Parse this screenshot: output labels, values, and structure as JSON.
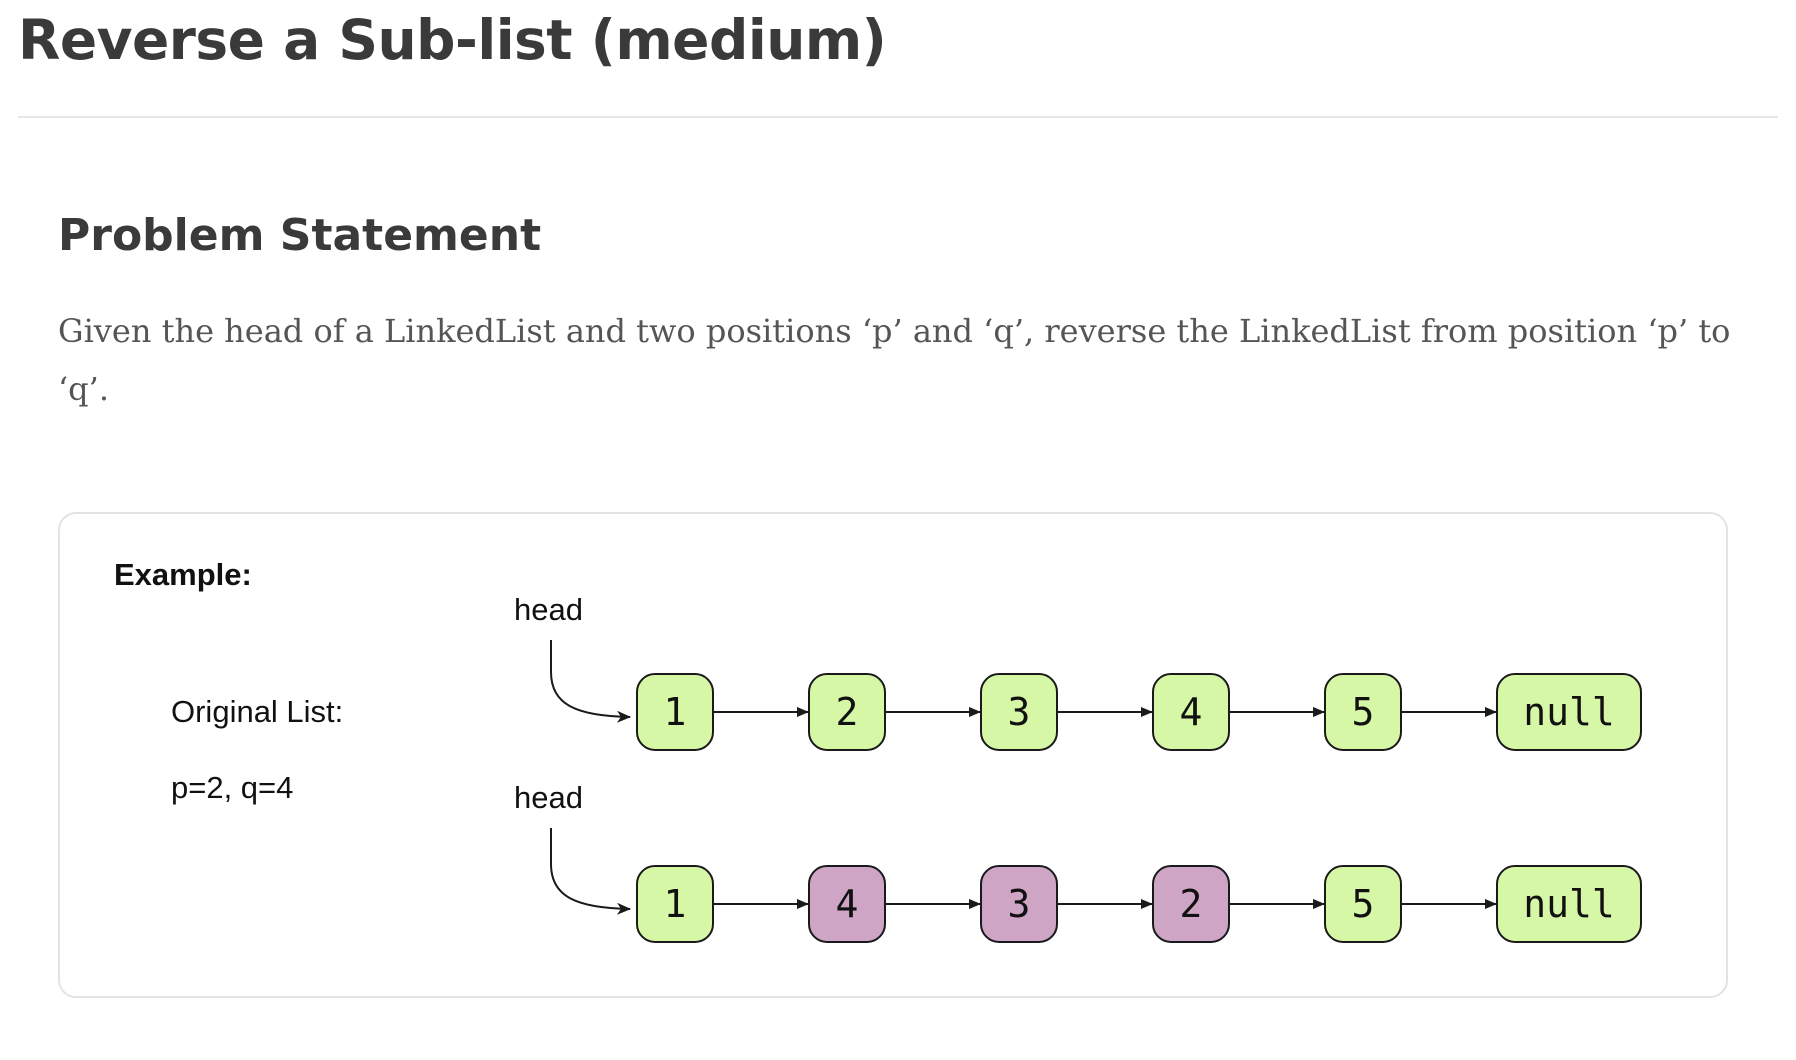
{
  "header": {
    "title": "Reverse a Sub-list (medium)"
  },
  "problem": {
    "heading": "Problem Statement",
    "text": "Given the head of a LinkedList and two positions ‘p’ and ‘q’, reverse the LinkedList from position ‘p’ to ‘q’."
  },
  "example": {
    "title": "Example:",
    "original_label": "Original List:",
    "params_label": "p=2, q=4",
    "head_label": "head",
    "lists": [
      {
        "name": "original",
        "nodes": [
          {
            "value": "1",
            "highlighted": false
          },
          {
            "value": "2",
            "highlighted": false
          },
          {
            "value": "3",
            "highlighted": false
          },
          {
            "value": "4",
            "highlighted": false
          },
          {
            "value": "5",
            "highlighted": false
          },
          {
            "value": "null",
            "highlighted": false
          }
        ]
      },
      {
        "name": "reversed",
        "nodes": [
          {
            "value": "1",
            "highlighted": false
          },
          {
            "value": "4",
            "highlighted": true
          },
          {
            "value": "3",
            "highlighted": true
          },
          {
            "value": "2",
            "highlighted": true
          },
          {
            "value": "5",
            "highlighted": false
          },
          {
            "value": "null",
            "highlighted": false
          }
        ]
      }
    ]
  },
  "colors": {
    "node_fill": "#d6f8a6",
    "node_highlight_fill": "#cfa5c6",
    "node_stroke": "#1a1a1a",
    "text": "#3a3a3a",
    "divider": "#e6e6e6"
  }
}
